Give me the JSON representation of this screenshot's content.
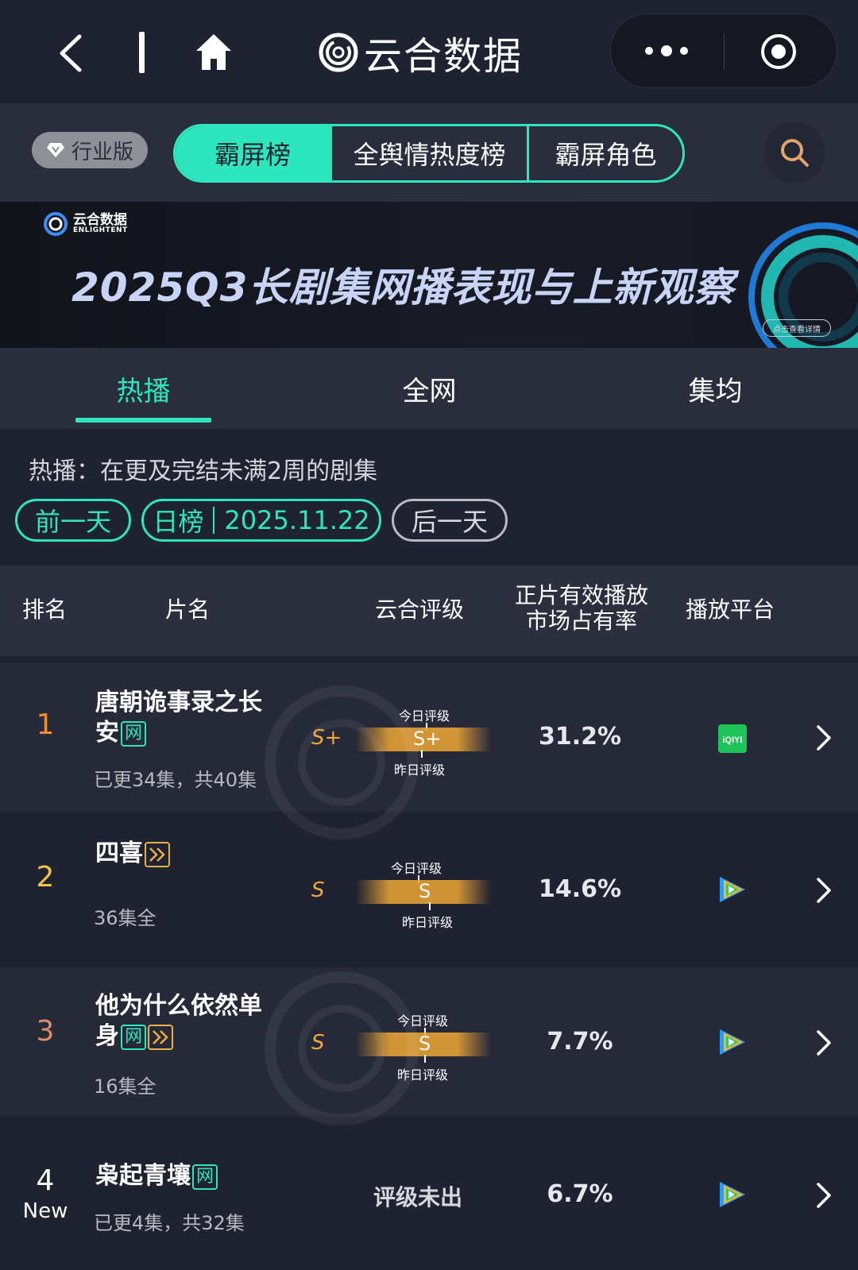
{
  "titlebar": {
    "title": "云合数据"
  },
  "tabs": {
    "edition_label": "行业版",
    "items": [
      {
        "label": "霸屏榜",
        "active": true
      },
      {
        "label": "全舆情热度榜",
        "active": false
      },
      {
        "label": "霸屏角色",
        "active": false
      }
    ]
  },
  "banner": {
    "logo_cn": "云合数据",
    "logo_en": "ENLIGHTENT",
    "title": "2025Q3长剧集网播表现与上新观察",
    "cta": "点击查看详情"
  },
  "subtabs": [
    {
      "label": "热播",
      "active": true
    },
    {
      "label": "全网",
      "active": false
    },
    {
      "label": "集均",
      "active": false
    }
  ],
  "filter": {
    "description": "热播：在更及完结未满2周的剧集",
    "prev_label": "前一天",
    "period_label": "日榜",
    "date": "2025.11.22",
    "next_label": "后一天"
  },
  "table": {
    "headers": {
      "rank": "排名",
      "title": "片名",
      "grade": "云合评级",
      "share_line1": "正片有效播放",
      "share_line2": "市场占有率",
      "platform": "播放平台"
    },
    "today_grade_label": "今日评级",
    "yesterday_grade_label": "昨日评级",
    "rows": [
      {
        "rank": "1",
        "title": "唐朝诡事录之长安",
        "tags": [
          "网"
        ],
        "episodes": "已更34集，共40集",
        "grade_left": "S+",
        "grade_today": "S+",
        "share": "31.2%",
        "platform": "iQIYI"
      },
      {
        "rank": "2",
        "title": "四喜",
        "tags": [
          "play"
        ],
        "episodes": "36集全",
        "grade_left": "S",
        "grade_today": "S",
        "share": "14.6%",
        "platform": "tencent-video"
      },
      {
        "rank": "3",
        "title": "他为什么依然单身",
        "tags": [
          "网",
          "play"
        ],
        "episodes": "16集全",
        "grade_left": "S",
        "grade_today": "S",
        "share": "7.7%",
        "platform": "tencent-video"
      },
      {
        "rank": "4",
        "rank_badge": "New",
        "title": "枭起青壤",
        "tags": [
          "网"
        ],
        "episodes": "已更4集，共32集",
        "grade_pending": "评级未出",
        "share": "6.7%",
        "platform": "tencent-video"
      }
    ]
  },
  "colors": {
    "accent": "#2ee6bd",
    "rank1": "#f28a2e",
    "rank2": "#f2c34a",
    "rank3": "#d98f6a",
    "grade": "#f0a836"
  },
  "icons": [
    "back-icon",
    "home-icon",
    "app-logo-icon",
    "more-icon",
    "target-icon",
    "diamond-icon",
    "search-icon",
    "chevron-right-icon",
    "iqiyi-icon",
    "tencent-video-icon",
    "play-tag-icon"
  ]
}
